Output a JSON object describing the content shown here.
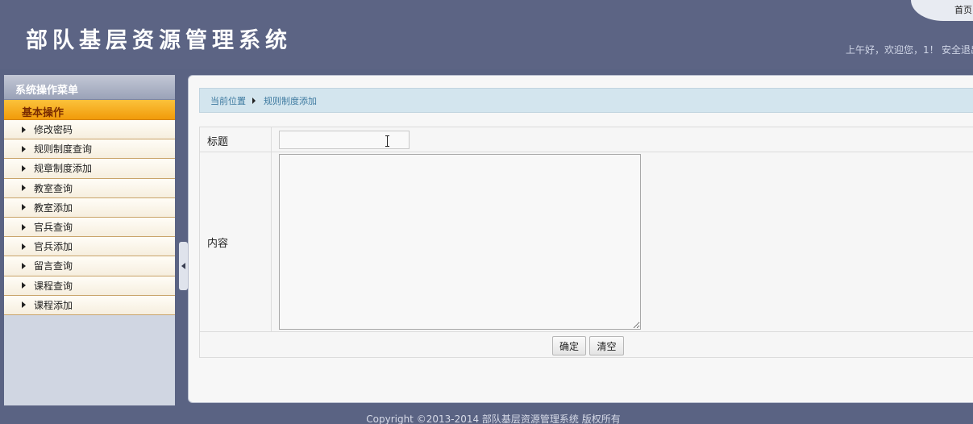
{
  "header": {
    "app_title": "部队基层资源管理系统",
    "home_link": "首页",
    "greeting": "上午好，欢迎您，1！",
    "logout_link": "安全退出"
  },
  "sidebar": {
    "title": "系统操作菜单",
    "group_label": "基本操作",
    "items": [
      {
        "label": "修改密码"
      },
      {
        "label": "规则制度查询"
      },
      {
        "label": "规章制度添加"
      },
      {
        "label": "教室查询"
      },
      {
        "label": "教室添加"
      },
      {
        "label": "官兵查询"
      },
      {
        "label": "官兵添加"
      },
      {
        "label": "留言查询"
      },
      {
        "label": "课程查询"
      },
      {
        "label": "课程添加"
      }
    ]
  },
  "breadcrumb": {
    "current_label": "当前位置",
    "page": "规则制度添加"
  },
  "form": {
    "title_label": "标题",
    "title_value": "",
    "content_label": "内容",
    "content_value": "",
    "submit_label": "确定",
    "reset_label": "清空"
  },
  "footer": {
    "copyright": "Copyright ©2013-2014 部队基层资源管理系统 版权所有"
  },
  "colors": {
    "header_bg": "#5c6484",
    "menu_group": "#f5a81f",
    "breadcrumb_bg": "#d3e5ee"
  }
}
